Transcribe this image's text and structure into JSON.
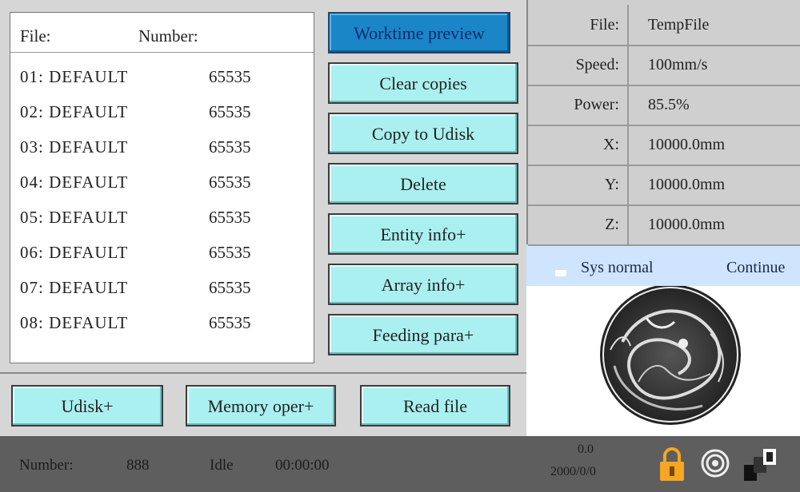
{
  "file_list": {
    "header": {
      "file_label": "File:",
      "number_label": "Number:"
    },
    "rows": [
      {
        "name": "01: DEFAULT",
        "count": "65535"
      },
      {
        "name": "02: DEFAULT",
        "count": "65535"
      },
      {
        "name": "03: DEFAULT",
        "count": "65535"
      },
      {
        "name": "04: DEFAULT",
        "count": "65535"
      },
      {
        "name": "05: DEFAULT",
        "count": "65535"
      },
      {
        "name": "06: DEFAULT",
        "count": "65535"
      },
      {
        "name": "07: DEFAULT",
        "count": "65535"
      },
      {
        "name": "08: DEFAULT",
        "count": "65535"
      }
    ]
  },
  "side_buttons": {
    "worktime_preview": "Worktime preview",
    "clear_copies": "Clear copies",
    "copy_to_udisk": "Copy to Udisk",
    "delete": "Delete",
    "entity_info": "Entity info+",
    "array_info": "Array info+",
    "feeding_para": "Feeding para+"
  },
  "bottom_buttons": {
    "udisk": "Udisk+",
    "memory_oper": "Memory oper+",
    "read_file": "Read file"
  },
  "info": {
    "file": {
      "label": "File:",
      "value": "TempFile"
    },
    "speed": {
      "label": "Speed:",
      "value": "100mm/s"
    },
    "power": {
      "label": "Power:",
      "value": "85.5%"
    },
    "x": {
      "label": "X:",
      "value": "10000.0mm"
    },
    "y": {
      "label": "Y:",
      "value": "10000.0mm"
    },
    "z": {
      "label": "Z:",
      "value": "10000.0mm"
    }
  },
  "status": {
    "text": "Sys normal",
    "mode": "Continue"
  },
  "footer": {
    "number_label": "Number:",
    "number_value": "888",
    "state": "Idle",
    "time": "00:00:00",
    "top_value": "0.0",
    "date": "2000/0/0"
  },
  "colors": {
    "button_bg": "#aaf0f0",
    "active_button_bg": "#1a86c8",
    "status_bg": "#cfe4ff",
    "footer_bg": "#5e5e5e",
    "lock_color": "#f5a623"
  },
  "icons": [
    "lock-icon",
    "wifi-icon",
    "usb-icon"
  ]
}
